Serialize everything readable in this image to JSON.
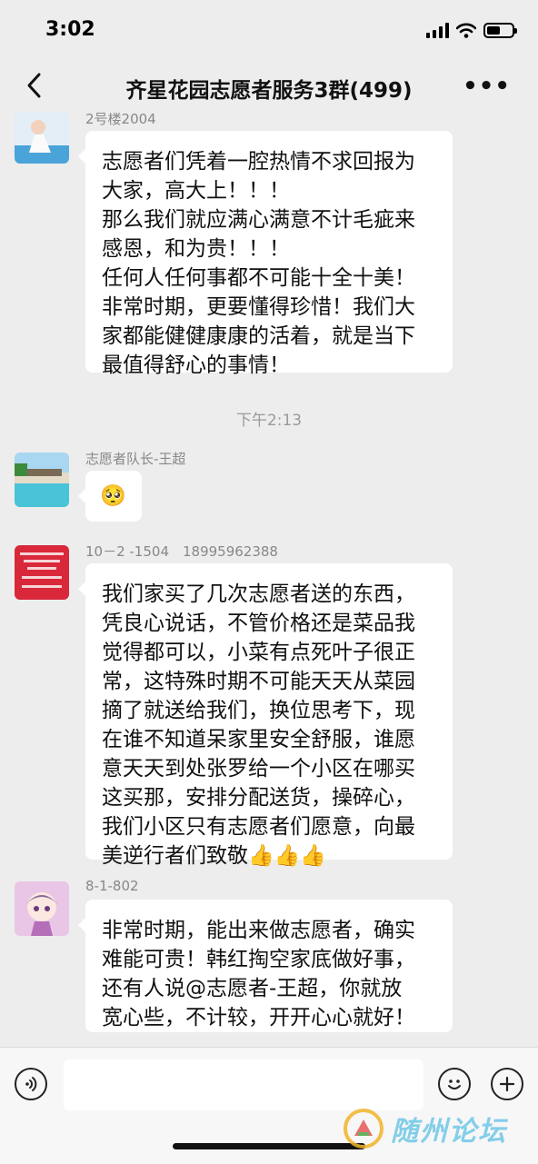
{
  "status_bar": {
    "time": "3:02"
  },
  "nav": {
    "title": "齐星花园志愿者服务3群(499)",
    "back_icon": "chevron-left-icon",
    "more_label": "•••"
  },
  "messages": [
    {
      "sender": "2号楼2004",
      "text": "志愿者们凭着一腔热情不求回报为\n大家，高大上！！！\n那么我们就应满心满意不计毛疵来\n感恩，和为贵！！！\n任何人任何事都不可能十全十美！\n非常时期，更要懂得珍惜！我们大\n家都能健健康康的活着，就是当下\n最值得舒心的事情！"
    },
    {
      "timestamp": "下午2:13"
    },
    {
      "sender": "志愿者队长-王超",
      "text": "🥺"
    },
    {
      "sender": "10－2 -1504　18995962388",
      "text": "我们家买了几次志愿者送的东西，\n凭良心说话，不管价格还是菜品我\n觉得都可以，小菜有点死叶子很正\n常，这特殊时期不可能天天从菜园\n摘了就送给我们，换位思考下，现\n在谁不知道呆家里安全舒服，谁愿\n意天天到处张罗给一个小区在哪买\n这买那，安排分配送货，操碎心，\n我们小区只有志愿者们愿意，向最\n美逆行者们致敬👍👍👍"
    },
    {
      "sender": "8-1-802",
      "text": "非常时期，能出来做志愿者，确实\n难能可贵！韩红掏空家底做好事，\n还有人说@志愿者-王超，你就放\n宽心些，不计较，开开心心就好！"
    }
  ],
  "input_bar": {
    "voice_icon": "voice-icon",
    "emoji_icon": "emoji-icon",
    "plus_icon": "plus-icon"
  },
  "watermark": {
    "text": "随州论坛"
  },
  "colors": {
    "background": "#ededed",
    "bubble": "#ffffff",
    "meta_text": "#888888"
  }
}
